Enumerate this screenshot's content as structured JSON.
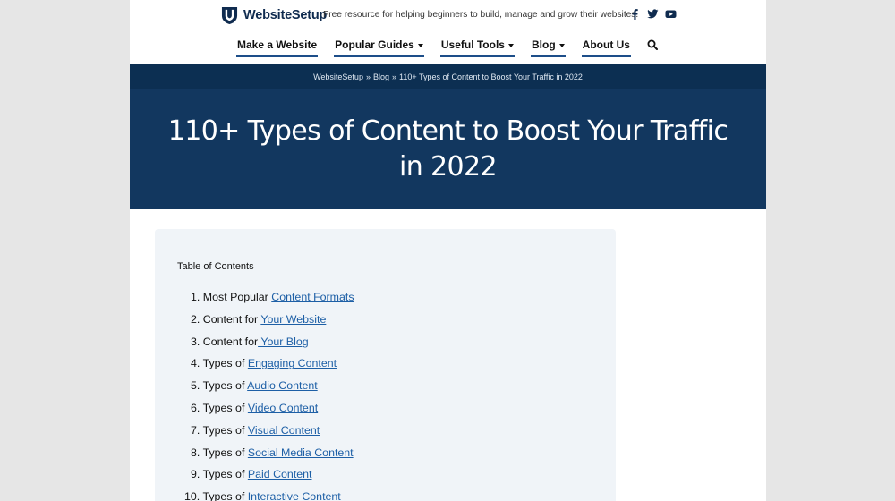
{
  "header": {
    "logo_text": "WebsiteSetup",
    "tagline": "Free resource for helping beginners to build, manage and grow their websites.",
    "social": [
      "facebook-icon",
      "twitter-icon",
      "youtube-icon"
    ]
  },
  "nav": {
    "items": [
      {
        "label": "Make a Website",
        "dropdown": false
      },
      {
        "label": "Popular Guides",
        "dropdown": true
      },
      {
        "label": "Useful Tools",
        "dropdown": true
      },
      {
        "label": "Blog",
        "dropdown": true
      },
      {
        "label": "About Us",
        "dropdown": false
      }
    ]
  },
  "breadcrumb": {
    "items": [
      "WebsiteSetup",
      "Blog",
      "110+ Types of Content to Boost Your Traffic in 2022"
    ],
    "separator": "»"
  },
  "hero": {
    "title": "110+ Types of Content to Boost Your Traffic in 2022"
  },
  "toc": {
    "title": "Table of Contents",
    "items": [
      {
        "num": "1.",
        "prefix": "Most Popular ",
        "link": "Content Formats"
      },
      {
        "num": "2.",
        "prefix": "Content for ",
        "link": "Your Website"
      },
      {
        "num": "3.",
        "prefix": "Content for",
        "link": " Your Blog"
      },
      {
        "num": "4.",
        "prefix": "Types of ",
        "link": "Engaging Content"
      },
      {
        "num": "5.",
        "prefix": "Types of ",
        "link": "Audio Content"
      },
      {
        "num": "6.",
        "prefix": "Types of ",
        "link": "Video Content"
      },
      {
        "num": "7.",
        "prefix": "Types of ",
        "link": "Visual Content"
      },
      {
        "num": "8.",
        "prefix": "Types of ",
        "link": "Social Media Content"
      },
      {
        "num": "9.",
        "prefix": "Types of ",
        "link": "Paid Content"
      },
      {
        "num": "10.",
        "prefix": "Types of ",
        "link": "Interactive Content"
      }
    ]
  },
  "colors": {
    "brand_navy": "#12375f",
    "breadcrumb_bg": "#0c2f52",
    "link": "#1d5fa6",
    "toc_bg": "#f0f4f8"
  }
}
